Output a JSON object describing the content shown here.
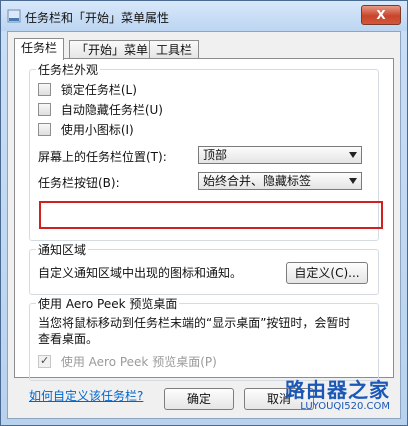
{
  "window": {
    "title": "任务栏和「开始」菜单属性",
    "close_label": "X"
  },
  "tabs": [
    {
      "label": "任务栏",
      "active": true
    },
    {
      "label": "「开始」菜单",
      "active": false
    },
    {
      "label": "工具栏",
      "active": false
    }
  ],
  "taskbar_appearance": {
    "title": "任务栏外观",
    "lock_taskbar": {
      "label": "锁定任务栏(L)",
      "checked": false
    },
    "auto_hide": {
      "label": "自动隐藏任务栏(U)",
      "checked": false
    },
    "small_icons": {
      "label": "使用小图标(I)",
      "checked": false
    }
  },
  "taskbar_position": {
    "label": "屏幕上的任务栏位置(T):",
    "value": "顶部"
  },
  "taskbar_buttons": {
    "label": "任务栏按钮(B):",
    "value": "始终合并、隐藏标签"
  },
  "notification_area": {
    "title": "通知区域",
    "description": "自定义通知区域中出现的图标和通知。",
    "customize_button": "自定义(C)..."
  },
  "aero_peek": {
    "title": "使用 Aero Peek 预览桌面",
    "description_line1": "当您将鼠标移动到任务栏末端的“显示桌面”按钮时，会暂时",
    "description_line2": "查看桌面。",
    "checkbox_label": "使用 Aero Peek 预览桌面(P)",
    "checked": true
  },
  "help_link": "如何自定义该任务栏?",
  "buttons": {
    "ok": "确定",
    "cancel": "取消"
  },
  "watermark": {
    "line1": "路由器之家",
    "line2": "LUYOUQI520.COM"
  },
  "colors": {
    "highlight_border": "#d02020",
    "link": "#0066cc",
    "title_bar": "#bcd5f1"
  }
}
